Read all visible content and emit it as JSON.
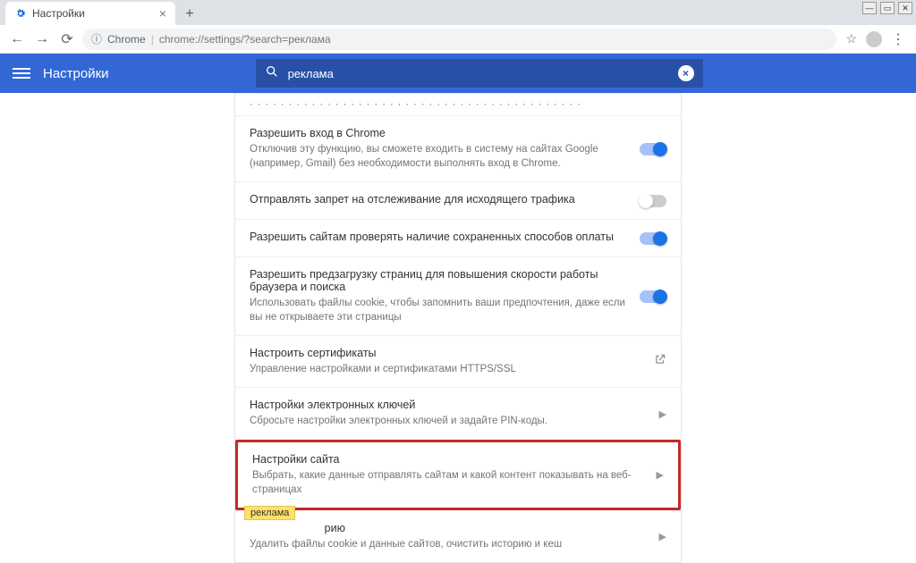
{
  "window": {
    "min": "—",
    "max": "▭",
    "close": "✕"
  },
  "tab": {
    "title": "Настройки"
  },
  "toolbar": {
    "proto": "Chrome",
    "url": "chrome://settings/?search=реклама"
  },
  "header": {
    "title": "Настройки",
    "search_value": "реклама"
  },
  "rows": {
    "r0": {
      "title": "",
      "sub": ""
    },
    "r1": {
      "title": "Разрешить вход в Chrome",
      "sub": "Отключив эту функцию, вы сможете входить в систему на сайтах Google (например, Gmail) без необходимости выполнять вход в Chrome."
    },
    "r2": {
      "title": "Отправлять запрет на отслеживание для исходящего трафика"
    },
    "r3": {
      "title": "Разрешить сайтам проверять наличие сохраненных способов оплаты"
    },
    "r4": {
      "title": "Разрешить предзагрузку страниц для повышения скорости работы браузера и поиска",
      "sub": "Использовать файлы cookie, чтобы запомнить ваши предпочтения, даже если вы не открываете эти страницы"
    },
    "r5": {
      "title": "Настроить сертификаты",
      "sub": "Управление настройками и сертификатами HTTPS/SSL"
    },
    "r6": {
      "title": "Настройки электронных ключей",
      "sub": "Сбросьте настройки электронных ключей и задайте PIN-коды."
    },
    "r7": {
      "title": "Настройки сайта",
      "sub": "Выбрать, какие данные отправлять сайтам и какой контент показывать на веб-страницах"
    },
    "r8": {
      "title": "рию",
      "sub": "Удалить файлы cookie и данные сайтов, очистить историю и кеш",
      "hl": "реклама"
    }
  }
}
